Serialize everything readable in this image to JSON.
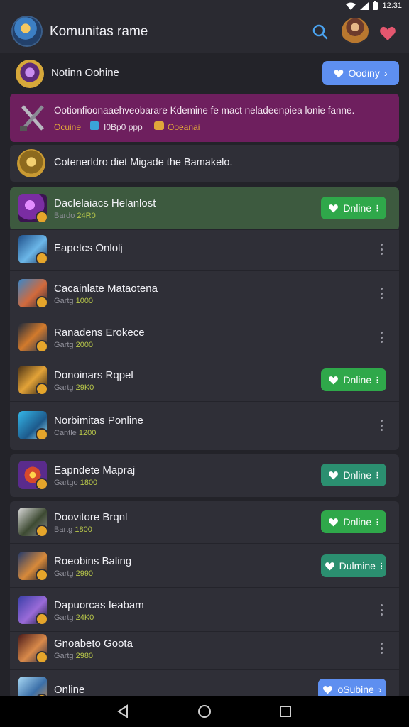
{
  "status": {
    "time": "12:31"
  },
  "appbar": {
    "title": "Komunitas rame"
  },
  "profile_row": {
    "name": "Notinn Oohine",
    "button": "Oodiny"
  },
  "banner": {
    "text": "Ootionfioonaaehveobarare Kdemine fe mact neladeenpiea lonie fanne.",
    "left": "Ocuine",
    "middle": "I0Bp0 ppp",
    "right": "Ooeanai"
  },
  "notice": {
    "text": "Cotenerldro diet Migade the Bamakelo."
  },
  "colors": {
    "online_green": "#2fa84a",
    "online_teal": "#2b8f70",
    "accent_blue": "#5e8ff0",
    "highlight_green": "#3d5a3f",
    "banner_purple": "#6e1f5e"
  },
  "players": [
    {
      "name": "Daclelaiacs Helanlost",
      "sub_label": "Bardo",
      "sub_value": "24R0",
      "status": "Dnline"
    },
    {
      "name": "Eapetcs Onlolj",
      "sub_label": "",
      "sub_value": "",
      "status": ""
    },
    {
      "name": "Cacainlate Mataotena",
      "sub_label": "Gartg",
      "sub_value": "1000",
      "status": ""
    },
    {
      "name": "Ranadens Erokece",
      "sub_label": "Gartg",
      "sub_value": "2000",
      "status": ""
    },
    {
      "name": "Donoinars Rqpel",
      "sub_label": "Gartg",
      "sub_value": "29K0",
      "status": "Dnline"
    },
    {
      "name": "Norbimitas Ponline",
      "sub_label": "Cantle",
      "sub_value": "1200",
      "status": ""
    },
    {
      "name": "Eapndete Mapraj",
      "sub_label": "Gartgo",
      "sub_value": "1800",
      "status": "Dnline"
    },
    {
      "name": "Doovitore Brqnl",
      "sub_label": "Bartg",
      "sub_value": "1800",
      "status": "Dnline"
    },
    {
      "name": "Roeobins Baling",
      "sub_label": "Gartg",
      "sub_value": "2990",
      "status": "Dulmine"
    },
    {
      "name": "Dapuorcas Ieabam",
      "sub_label": "Gartg",
      "sub_value": "24K0",
      "status": ""
    },
    {
      "name": "Gnoabeto Goota",
      "sub_label": "Gartg",
      "sub_value": "2980",
      "status": ""
    },
    {
      "name": "Online",
      "sub_label": "",
      "sub_value": "",
      "status": "oSubine"
    }
  ]
}
